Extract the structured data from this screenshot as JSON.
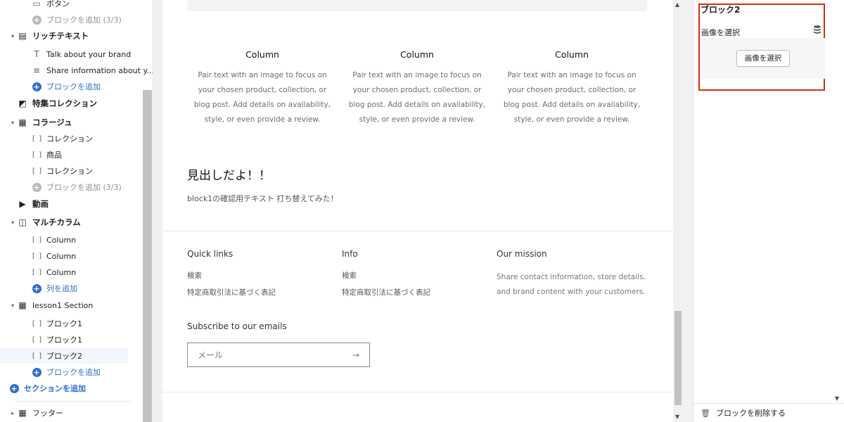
{
  "sidebar": {
    "items": [
      {
        "label": "ボタン",
        "kind": "block",
        "icon": "button-icon"
      },
      {
        "label": "ブロックを追加 (3/3)",
        "kind": "add-disabled"
      },
      {
        "label": "リッチテキスト",
        "kind": "section",
        "icon": "text-block-icon",
        "expanded": true
      },
      {
        "label": "Talk about your brand",
        "kind": "block",
        "icon": "heading-icon"
      },
      {
        "label": "Share information about y...",
        "kind": "block",
        "icon": "paragraph-icon"
      },
      {
        "label": "ブロックを追加",
        "kind": "add"
      },
      {
        "label": "特集コレクション",
        "kind": "section",
        "icon": "collection-icon",
        "expanded": null
      },
      {
        "label": "コラージュ",
        "kind": "section",
        "icon": "layout-icon",
        "expanded": true
      },
      {
        "label": "コレクション",
        "kind": "block",
        "icon": "bracket-icon"
      },
      {
        "label": "商品",
        "kind": "block",
        "icon": "bracket-icon"
      },
      {
        "label": "コレクション",
        "kind": "block",
        "icon": "bracket-icon"
      },
      {
        "label": "ブロックを追加 (3/3)",
        "kind": "add-disabled"
      },
      {
        "label": "動画",
        "kind": "section",
        "icon": "play-icon",
        "expanded": null
      },
      {
        "label": "マルチカラム",
        "kind": "section",
        "icon": "columns-icon",
        "expanded": true
      },
      {
        "label": "Column",
        "kind": "block",
        "icon": "bracket-icon"
      },
      {
        "label": "Column",
        "kind": "block",
        "icon": "bracket-icon"
      },
      {
        "label": "Column",
        "kind": "block",
        "icon": "bracket-icon"
      },
      {
        "label": "列を追加",
        "kind": "add"
      },
      {
        "label": "lesson1 Section",
        "kind": "section-light",
        "icon": "layout-icon",
        "expanded": true
      },
      {
        "label": "ブロック1",
        "kind": "block",
        "icon": "bracket-icon"
      },
      {
        "label": "ブロック1",
        "kind": "block",
        "icon": "bracket-icon"
      },
      {
        "label": "ブロック2",
        "kind": "block-selected",
        "icon": "bracket-icon"
      },
      {
        "label": "ブロックを追加",
        "kind": "add"
      },
      {
        "label": "セクションを追加",
        "kind": "add-section"
      },
      {
        "label": "フッター",
        "kind": "section-light",
        "icon": "layout-icon",
        "expanded": false
      }
    ]
  },
  "preview": {
    "columns": [
      {
        "title": "Column",
        "text": [
          "Pair text with an image to focus on",
          "your chosen product, collection, or",
          "blog post. Add details on availability,",
          "style, or even provide a review."
        ]
      },
      {
        "title": "Column",
        "text": [
          "Pair text with an image to focus on",
          "your chosen product, collection, or",
          "blog post. Add details on availability,",
          "style, or even provide a review."
        ]
      },
      {
        "title": "Column",
        "text": [
          "Pair text with an image to focus on",
          "your chosen product, collection, or",
          "blog post. Add details on availability,",
          "style, or even provide a review."
        ]
      }
    ],
    "headline": "見出しだよ！！",
    "subtext": "block1の確認用テキスト 打ち替えてみた！",
    "footer": {
      "quick_links": {
        "title": "Quick links",
        "links": [
          "検索",
          "特定商取引法に基づく表記"
        ]
      },
      "info": {
        "title": "Info",
        "links": [
          "検索",
          "特定商取引法に基づく表記"
        ]
      },
      "mission": {
        "title": "Our mission",
        "text": "Share contact information, store details, and brand content with your customers."
      },
      "subscribe_title": "Subscribe to our emails",
      "email_placeholder": "メール",
      "arrow": "→"
    }
  },
  "panel": {
    "block_title": "ブロック2",
    "image_label": "画像を選択",
    "select_button": "画像を選択",
    "delete_label": "ブロックを削除する"
  },
  "colors": {
    "accent": "#2c6ecb",
    "highlight_border": "#d72c0d",
    "selected_row": "#f2f7fe"
  }
}
